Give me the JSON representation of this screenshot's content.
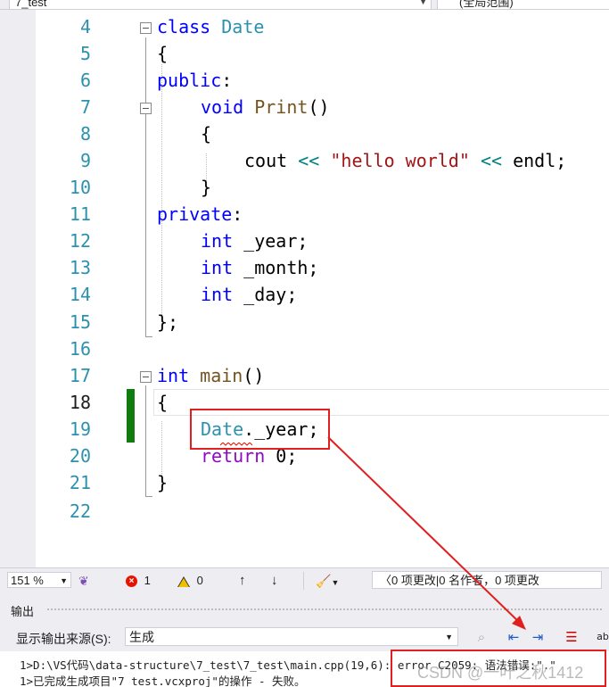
{
  "top_bar": {
    "project": "7_test",
    "scope": "(全局范围)"
  },
  "code_lines": [
    {
      "n": "4",
      "code": "class Date"
    },
    {
      "n": "5",
      "code": "{"
    },
    {
      "n": "6",
      "code": "public:"
    },
    {
      "n": "7",
      "code": "    void Print()"
    },
    {
      "n": "8",
      "code": "    {"
    },
    {
      "n": "9",
      "code": "        cout << \"hello world\" << endl;"
    },
    {
      "n": "10",
      "code": "    }"
    },
    {
      "n": "11",
      "code": "private:"
    },
    {
      "n": "12",
      "code": "    int _year;"
    },
    {
      "n": "13",
      "code": "    int _month;"
    },
    {
      "n": "14",
      "code": "    int _day;"
    },
    {
      "n": "15",
      "code": "};"
    },
    {
      "n": "16",
      "code": ""
    },
    {
      "n": "17",
      "code": "int main()"
    },
    {
      "n": "18",
      "code": "{"
    },
    {
      "n": "19",
      "code": "    Date._year;"
    },
    {
      "n": "20",
      "code": "    return 0;"
    },
    {
      "n": "21",
      "code": "}"
    },
    {
      "n": "22",
      "code": ""
    }
  ],
  "tokens": {
    "class_kw": "class",
    "date": "Date",
    "brace_open": "{",
    "public_kw": "public",
    "colon": ":",
    "void_kw": "void",
    "print_fn": "Print",
    "parens": "()",
    "cout": "cout",
    "shl": "<<",
    "hello": "\"hello world\"",
    "endl": "endl",
    "semicolon": ";",
    "brace_close": "}",
    "private_kw": "private",
    "int_kw": "int",
    "year": "_year",
    "month": "_month",
    "day": "_day",
    "close_semi": "};",
    "main_fn": "main",
    "dot": ".",
    "return_kw": "return",
    "zero": "0"
  },
  "status_bar": {
    "zoom": "151 %",
    "errors": "1",
    "warnings": "0",
    "up_arrow": "↑",
    "down_arrow": "↓",
    "changes": "0 项更改|0 名作者，0 项更改"
  },
  "output": {
    "title": "输出",
    "source_label": "显示输出来源(S):",
    "source_value": "生成",
    "lines": [
      "1>D:\\VS代码\\data-structure\\7_test\\7_test\\main.cpp(19,6): error C2059: 语法错误:\".\"",
      "1>已完成生成项目\"7_test.vcxproj\"的操作 - 失败。"
    ]
  },
  "watermark": "CSDN @一叶之秋1412",
  "colors": {
    "keyword": "#0000ff",
    "type": "#2b91af",
    "string": "#a31515",
    "function": "#74531f",
    "operator": "#008080",
    "control": "#8f08c4",
    "annotation": "#e02020",
    "change_bar": "#107c10"
  }
}
